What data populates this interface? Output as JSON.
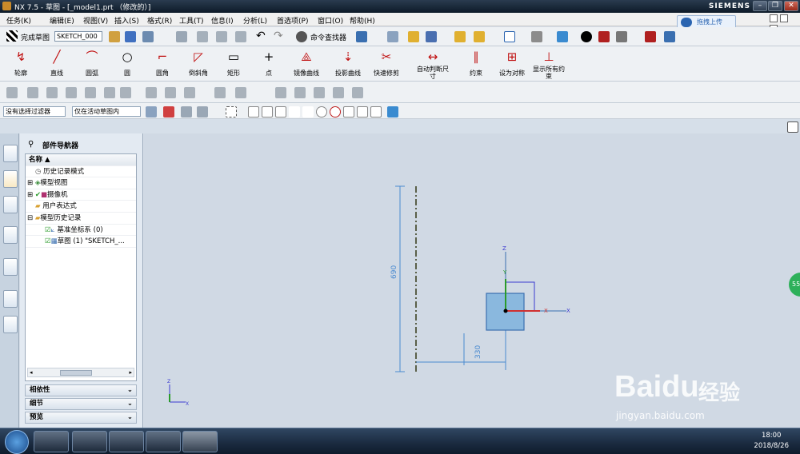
{
  "window": {
    "title": "NX 7.5 - 草图 - [_model1.prt （修改的）]",
    "brand": "SIEMENS",
    "btn_min": "–",
    "btn_max": "❐",
    "btn_close": "✕"
  },
  "menu": [
    "任务(K)",
    "编辑(E)",
    "视图(V)",
    "插入(S)",
    "格式(R)",
    "工具(T)",
    "信息(I)",
    "分析(L)",
    "首选项(P)",
    "窗口(O)",
    "帮助(H)"
  ],
  "cloud_button": "拖拽上传",
  "toolbar1": {
    "finish_sketch": "完成草图",
    "sketch_name": "SKETCH_000",
    "command_finder": "命令查找器"
  },
  "toolbar2": [
    {
      "label": "轮廓",
      "glyph": "↯"
    },
    {
      "label": "直线",
      "glyph": "╱"
    },
    {
      "label": "圆弧",
      "glyph": "⌒"
    },
    {
      "label": "圆",
      "glyph": "○"
    },
    {
      "label": "圆角",
      "glyph": "⌐"
    },
    {
      "label": "倒斜角",
      "glyph": "◸"
    },
    {
      "label": "矩形",
      "glyph": "▭"
    },
    {
      "label": "点",
      "glyph": "+"
    },
    {
      "label": "镜像曲线",
      "glyph": "⟁"
    },
    {
      "label": "投影曲线",
      "glyph": "⇣"
    },
    {
      "label": "快速修剪",
      "glyph": "✂"
    },
    {
      "label": "自动判断尺寸",
      "glyph": "↔"
    },
    {
      "label": "约束",
      "glyph": "∥"
    },
    {
      "label": "设为对称",
      "glyph": "⊞"
    },
    {
      "label": "显示所有约束",
      "glyph": "⊥"
    }
  ],
  "filters": {
    "selection_filter": "没有选择过滤器",
    "scope": "仅在活动草图内"
  },
  "navigator": {
    "title": "部件导航器",
    "column": "名称",
    "items": [
      {
        "label": "历史记录模式",
        "indent": 1
      },
      {
        "label": "模型视图",
        "indent": 1
      },
      {
        "label": "摄像机",
        "indent": 1
      },
      {
        "label": "用户表达式",
        "indent": 1
      },
      {
        "label": "模型历史记录",
        "indent": 1
      },
      {
        "label": "基准坐标系 (0)",
        "indent": 2
      },
      {
        "label": "草图 (1) \"SKETCH_...",
        "indent": 2
      }
    ],
    "sections": [
      "相依性",
      "细节",
      "预览"
    ]
  },
  "canvas": {
    "dim_vertical": "690",
    "dim_horizontal": "330",
    "axis_x": "X",
    "axis_y": "Y",
    "axis_z": "Z",
    "side_badge": "55"
  },
  "watermark": {
    "brand": "Baidu",
    "cn": "经验",
    "url": "jingyan.baidu.com"
  },
  "taskbar": {
    "time": "18:00",
    "date": "2018/8/26"
  },
  "colors": {
    "accent_blue": "#3a6fb0",
    "rect_fill": "#8ab8de",
    "dim_color": "#4a8ad0"
  }
}
